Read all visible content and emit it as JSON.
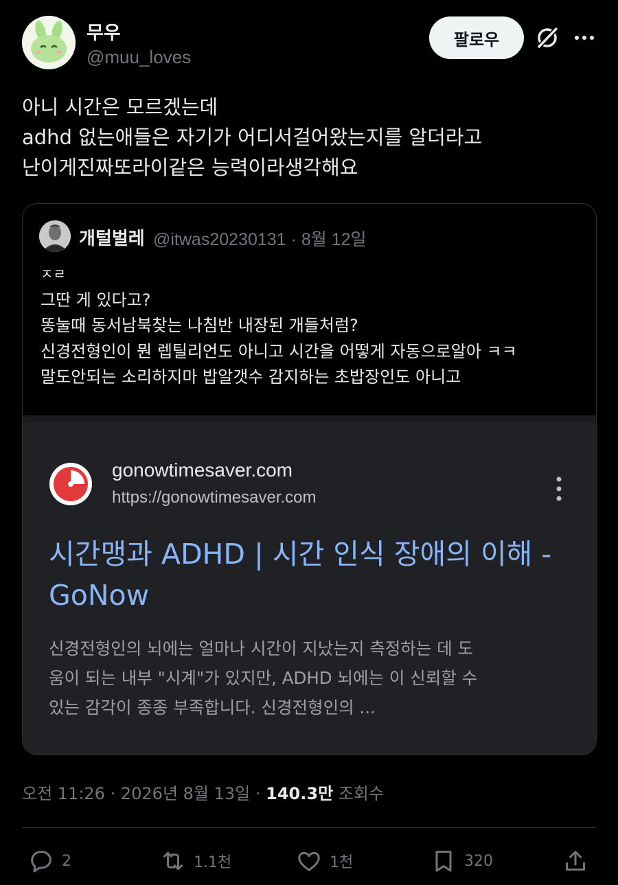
{
  "author": {
    "display_name": "무우",
    "handle": "@muu_loves",
    "follow_label": "팔로우"
  },
  "post": {
    "lines": [
      "아니 시간은 모르겠는데",
      "adhd 없는애들은 자기가 어디서걸어왔는지를 알더라고",
      "난이게진짜또라이같은 능력이라생각해요"
    ]
  },
  "quote": {
    "display_name": "개털벌레",
    "handle": "@itwas20230131",
    "date": "8월 12일",
    "lines": [
      "ㅈㄹ",
      "그딴 게 있다고?",
      "똥눌때 동서남북찾는 나침반 내장된 개들처럼?",
      "신경전형인이 뭔 렙틸리언도 아니고 시간을 어떻게 자동으로알아 ㅋㅋ",
      "말도안되는 소리하지마 밥알갯수 감지하는 초밥장인도 아니고"
    ],
    "embed": {
      "site_name": "gonowtimesaver.com",
      "site_url": "https://gonowtimesaver.com",
      "title": "시간맹과 ADHD | 시간 인식 장애의 이해 - GoNow",
      "description_lines": [
        "신경전형인의 뇌에는 얼마나 시간이 지났는지 측정하는 데 도",
        "움이 되는 내부 \"시계\"가 있지만, ADHD 뇌에는 이 신뢰할 수",
        "있는 감각이 종종 부족합니다. 신경전형인의 ..."
      ]
    }
  },
  "meta": {
    "time": "오전 11:26",
    "date": "2026년 8월 13일",
    "views_count": "140.3만",
    "views_label": "조회수"
  },
  "actions": {
    "replies": "2",
    "reposts": "1.1천",
    "likes": "1천",
    "bookmarks": "320"
  },
  "colors": {
    "background": "#000000",
    "text": "#e7e9ea",
    "muted": "#71767b",
    "link": "#8ab4f8",
    "embed_bg": "#202124",
    "border": "#2f3336"
  }
}
